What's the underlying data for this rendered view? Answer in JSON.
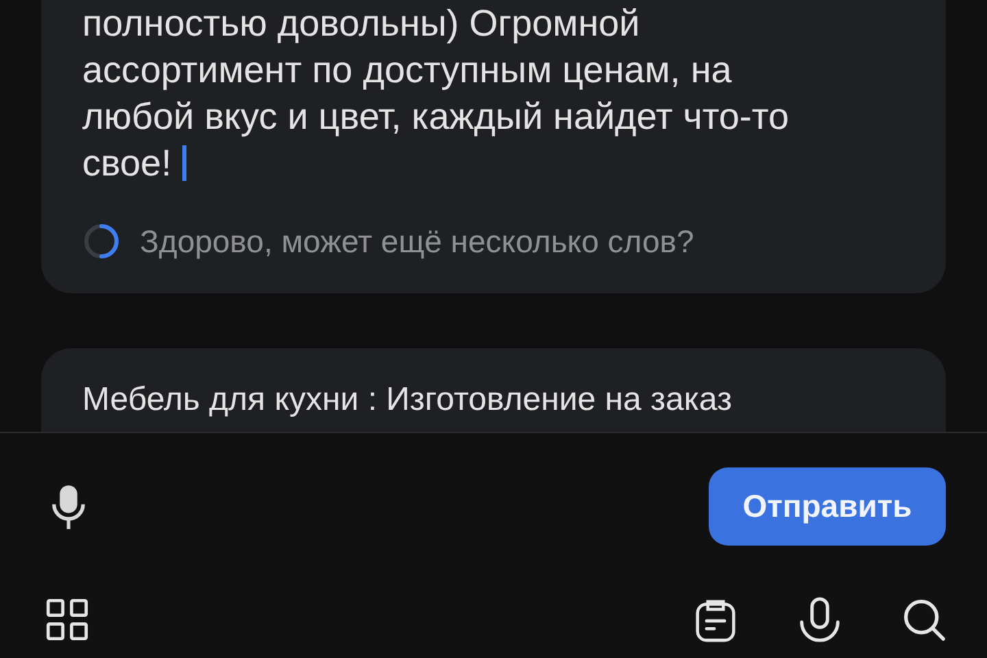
{
  "message_card": {
    "lines": [
      "полностью довольны) Огромной",
      "ассортимент по доступным ценам, на",
      "любой вкус и цвет, каждый найдет что-то",
      "свое!"
    ],
    "hint": "Здорово, может ещё несколько слов?"
  },
  "next_card": {
    "title": "Мебель для кухни : Изготовление на заказ"
  },
  "composer": {
    "send_button": "Отправить"
  }
}
